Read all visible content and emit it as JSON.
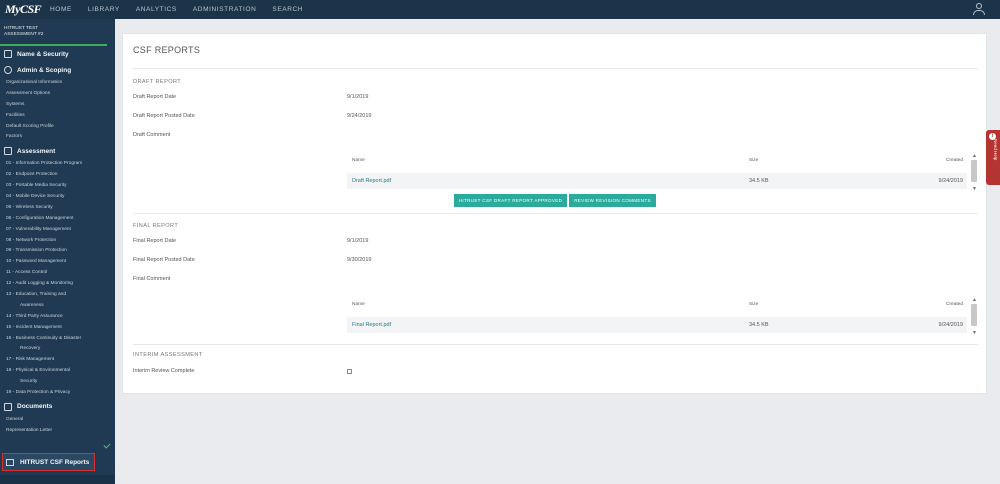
{
  "app": {
    "logo": "MyCSF"
  },
  "nav": [
    "HOME",
    "LIBRARY",
    "ANALYTICS",
    "ADMINISTRATION",
    "SEARCH"
  ],
  "sidebar": {
    "assessment_line1": "HITRUST TEST",
    "assessment_line2": "ASSESSMENT #2",
    "name_security": "Name & Security",
    "admin_scoping": "Admin & Scoping",
    "admin_items": [
      "Organizational Information",
      "Assessment Options",
      "Systems",
      "Facilities",
      "Default Scoring Profile",
      "Factors"
    ],
    "assessment": "Assessment",
    "assessment_items": [
      "01 - Information Protection Program",
      "02 - Endpoint Protection",
      "03 - Portable Media Security",
      "04 - Mobile Device Security",
      "05 - Wireless Security",
      "06 - Configuration Management",
      "07 - Vulnerability Management",
      "08 - Network Protection",
      "09 - Transmission Protection",
      "10 - Password Management",
      "11 - Access Control",
      "12 - Audit Logging & Monitoring",
      "13 - Education, Training and",
      "Awareness",
      "14 - Third Party Assurance",
      "15 - Incident Management",
      "16 - Business Continuity & Disaster",
      "Recovery",
      "17 - Risk Management",
      "18 - Physical & Environmental",
      "Security",
      "19 - Data Protection & Privacy"
    ],
    "documents": "Documents",
    "document_items": [
      "General",
      "Representation Letter"
    ],
    "csf_reports": "HITRUST CSF Reports"
  },
  "main": {
    "title": "CSF REPORTS",
    "draft": {
      "section": "DRAFT REPORT",
      "date_label": "Draft Report Date",
      "date_value": "9/1/2019",
      "posted_label": "Draft Report Posted Date",
      "posted_value": "9/24/2019",
      "comment_label": "Draft Comment",
      "table": {
        "headers": [
          "Name",
          "Size",
          "Created"
        ],
        "row": {
          "name": "Draft Report.pdf",
          "size": "34.5 KB",
          "created": "9/24/2019"
        }
      },
      "btn_approved": "HITRUST CSF DRAFT REPORT APPROVED",
      "btn_revision": "REVIEW REVISION COMMENTS"
    },
    "final": {
      "section": "FINAL REPORT",
      "date_label": "Final Report Date",
      "date_value": "9/1/2019",
      "posted_label": "Final Report Posted Date",
      "posted_value": "9/30/2019",
      "comment_label": "Final Comment",
      "table": {
        "headers": [
          "Name",
          "Size",
          "Created"
        ],
        "row": {
          "name": "Final Report.pdf",
          "size": "34.5 KB",
          "created": "9/24/2019"
        }
      }
    },
    "interim": {
      "section": "INTERIM ASSESSMENT",
      "review_label": "Interim Review Complete",
      "checked": false
    }
  },
  "help": {
    "label": "Need Help"
  },
  "colors": {
    "topbar": "#1c3449",
    "sidebar": "#1f3a52",
    "accent": "#2bab9e",
    "highlight": "#d9302f",
    "help": "#b33431"
  }
}
